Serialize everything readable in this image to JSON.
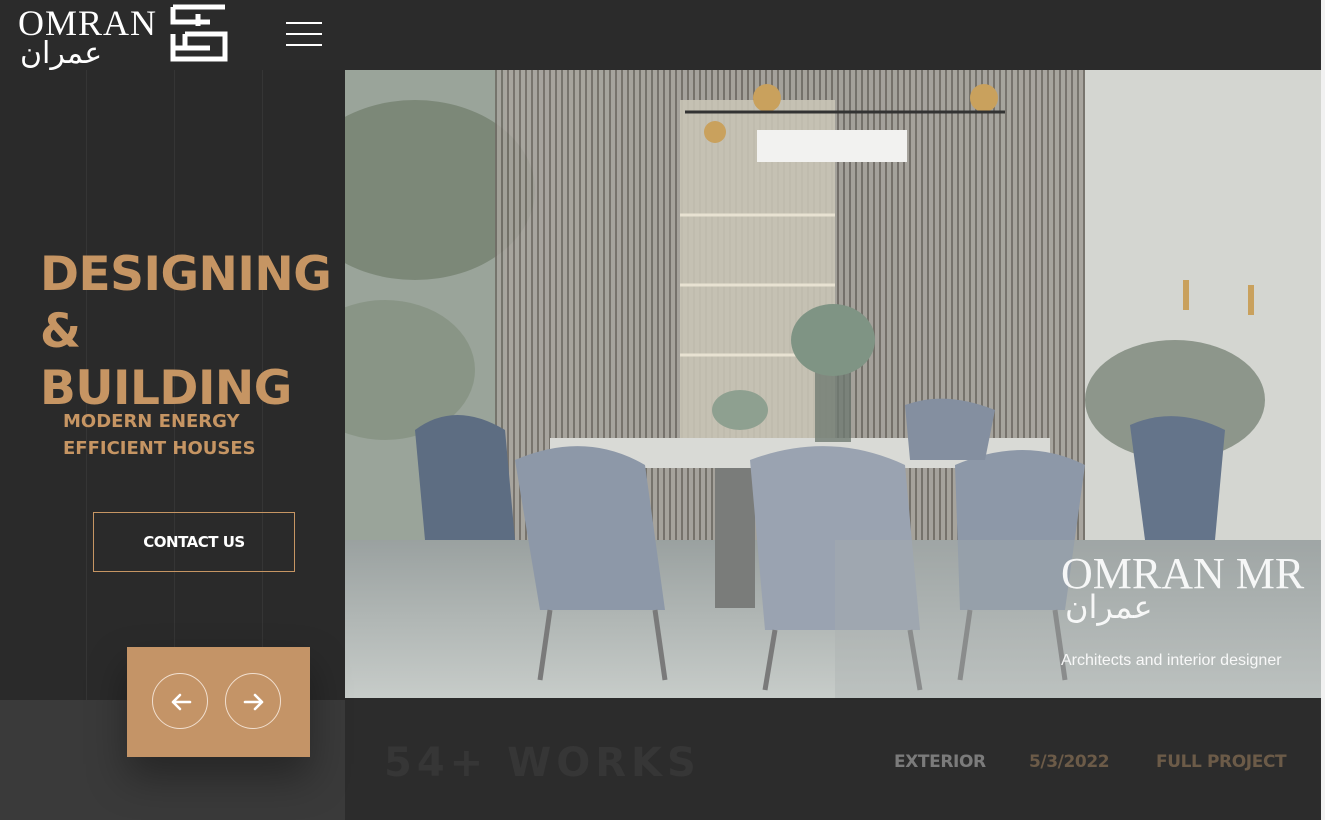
{
  "brand": {
    "name_latin": "OMRAN",
    "name_arabic": "عمران"
  },
  "hero": {
    "headline_line1": "DESIGNING",
    "headline_line2": "& BUILDING",
    "subline_line1": "MODERN ENERGY",
    "subline_line2": "EFFICIENT HOUSES",
    "contact_label": "CONTACT US"
  },
  "watermark": {
    "latin": "OMRAN MR",
    "arabic": "عمران",
    "tagline": "Architects and interior designer"
  },
  "project_info": {
    "works_count": "54+ WORKS",
    "category": "EXTERIOR",
    "date": "5/3/2022",
    "scope": "FULL PROJECT"
  },
  "icons": {
    "menu": "hamburger-icon",
    "prev": "arrow-left-icon",
    "next": "arrow-right-icon"
  },
  "colors": {
    "accent": "#c69563",
    "background": "#2a2a2a",
    "slider_box": "#c49467"
  }
}
